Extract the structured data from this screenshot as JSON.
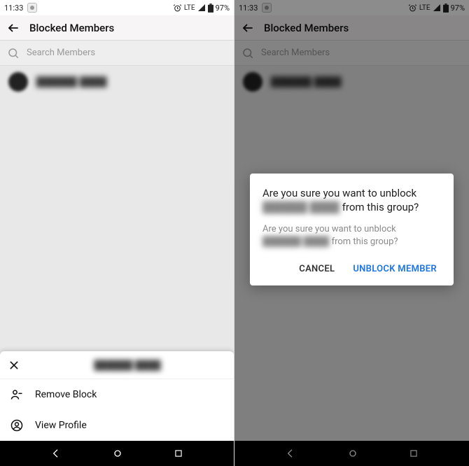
{
  "status": {
    "time": "11:33",
    "network": "LTE",
    "battery": "97%"
  },
  "header": {
    "title": "Blocked Members"
  },
  "search": {
    "placeholder": "Search Members"
  },
  "members": [
    {
      "name_redacted": "██████ ████"
    }
  ],
  "sheet": {
    "title_redacted": "██████ ████",
    "remove_block": "Remove Block",
    "view_profile": "View Profile"
  },
  "dialog": {
    "title_pre": "Are you sure you want to unblock ",
    "title_name_redacted": "██████ ████",
    "title_post": " from this group?",
    "body_pre": "Are you sure you want to unblock ",
    "body_name_redacted": "██████ ████",
    "body_post": " from this group?",
    "cancel": "CANCEL",
    "confirm": "UNBLOCK MEMBER"
  }
}
